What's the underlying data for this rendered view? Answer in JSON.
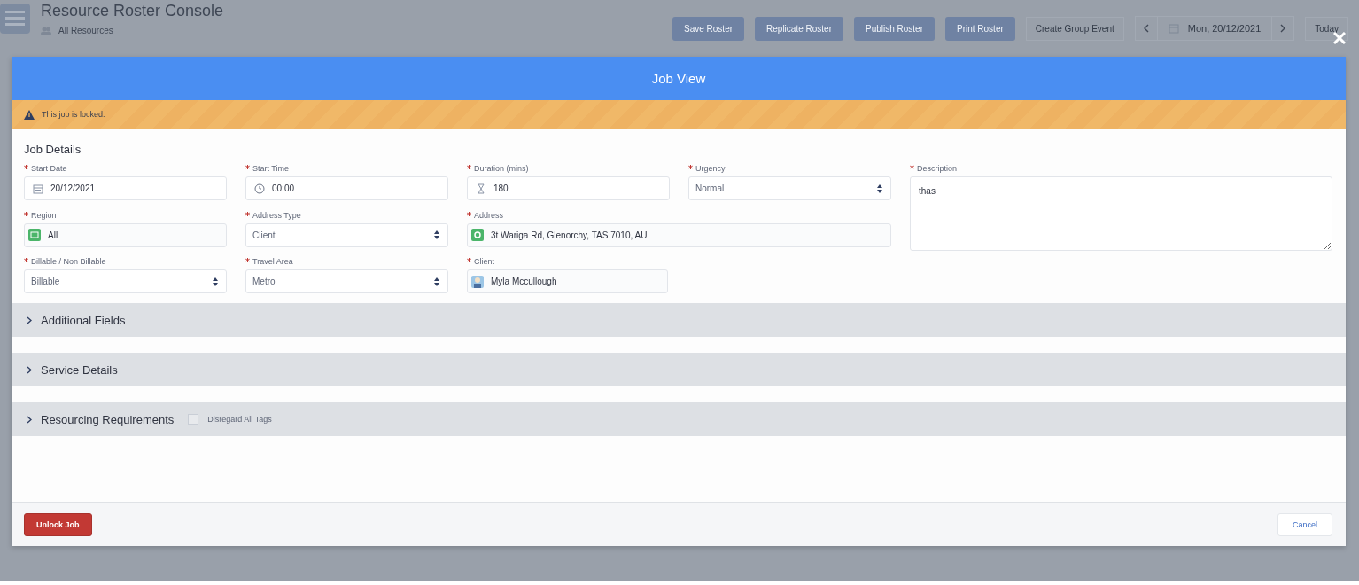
{
  "background": {
    "title": "Resource Roster Console",
    "subtitle": "All Resources",
    "buttons": [
      "Save Roster",
      "Replicate Roster",
      "Publish Roster",
      "Print Roster"
    ],
    "group_event": "Create Group Event",
    "date": "Mon, 20/12/2021",
    "today": "Today"
  },
  "modal": {
    "title": "Job View",
    "locked_notice": "This job is locked.",
    "section_title": "Job Details",
    "fields": [
      {
        "kind": "date",
        "label": "Start Date",
        "required": true,
        "value": "20/12/2021"
      },
      {
        "kind": "time",
        "label": "Start Time",
        "required": true,
        "value": "00:00"
      },
      {
        "kind": "duration",
        "label": "Duration (mins)",
        "required": true,
        "value": "180"
      },
      {
        "kind": "select",
        "label": "Urgency",
        "required": true,
        "value": "Normal"
      },
      {
        "kind": "textarea",
        "label": "Description",
        "required": true,
        "value": "thas"
      },
      {
        "kind": "region",
        "label": "Region",
        "required": true,
        "value": "All"
      },
      {
        "kind": "select",
        "label": "Address Type",
        "required": true,
        "value": "Client"
      },
      {
        "kind": "address",
        "label": "Address",
        "required": true,
        "value": "3t Wariga Rd, Glenorchy, TAS 7010, AU"
      },
      {
        "kind": "select",
        "label": "Billable / Non Billable",
        "required": true,
        "value": "Billable"
      },
      {
        "kind": "select",
        "label": "Travel Area",
        "required": true,
        "value": "Metro"
      },
      {
        "kind": "client",
        "label": "Client",
        "required": true,
        "value": "Myla Mccullough"
      }
    ],
    "sections": [
      {
        "title": "Additional Fields",
        "expanded": false
      },
      {
        "title": "Service Details",
        "expanded": false
      },
      {
        "title": "Resourcing Requirements",
        "expanded": false,
        "checkbox": {
          "label": "Disregard All Tags",
          "checked": false
        }
      }
    ],
    "buttons": [
      {
        "kind": "danger",
        "label": "Unlock Job"
      },
      {
        "kind": "neutral",
        "label": "Cancel"
      }
    ]
  }
}
